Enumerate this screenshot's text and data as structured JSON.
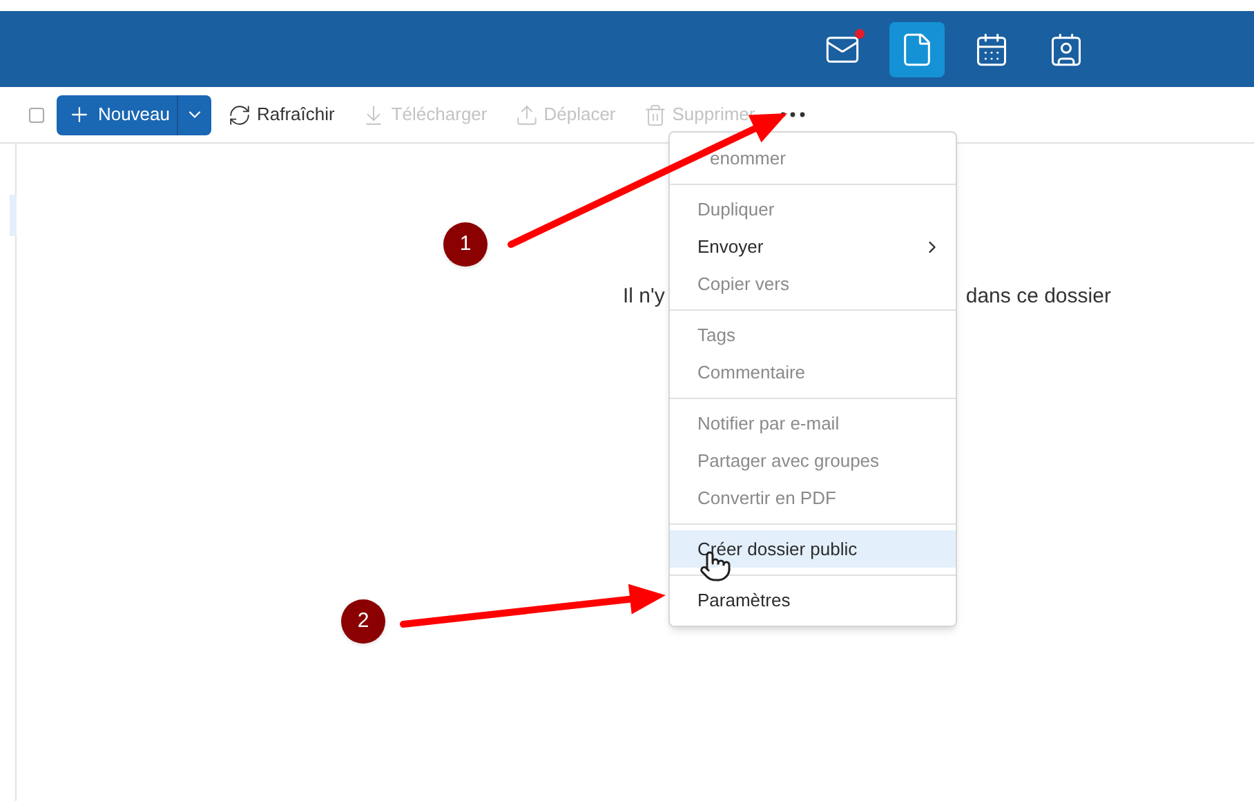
{
  "header": {
    "nav": [
      {
        "kind": "mail",
        "selected": false,
        "unread": true
      },
      {
        "kind": "files",
        "selected": true,
        "unread": false
      },
      {
        "kind": "calendar",
        "selected": false,
        "unread": false
      },
      {
        "kind": "contacts",
        "selected": false,
        "unread": false
      }
    ]
  },
  "toolbar": {
    "select_all": {
      "checked": false
    },
    "new_button": {
      "label": "Nouveau"
    },
    "actions": [
      {
        "kind": "refresh",
        "label": "Rafraîchir",
        "disabled": false
      },
      {
        "kind": "download",
        "label": "Télécharger",
        "disabled": true
      },
      {
        "kind": "move",
        "label": "Déplacer",
        "disabled": true
      },
      {
        "kind": "delete",
        "label": "Supprimer",
        "disabled": true
      }
    ]
  },
  "sidebar": {
    "items": [
      {
        "selected": true
      }
    ]
  },
  "empty_message": {
    "before": "Il n'y",
    "after": "dans ce dossier"
  },
  "context_menu": {
    "groups": [
      [
        {
          "label": "enommer",
          "disabled": true,
          "selected": false,
          "submenu": false
        }
      ],
      [
        {
          "label": "Dupliquer",
          "disabled": true,
          "selected": false,
          "submenu": false
        },
        {
          "label": "Envoyer",
          "disabled": false,
          "selected": false,
          "submenu": true
        },
        {
          "label": "Copier vers",
          "disabled": true,
          "selected": false,
          "submenu": false
        }
      ],
      [
        {
          "label": "Tags",
          "disabled": true,
          "selected": false,
          "submenu": false
        },
        {
          "label": "Commentaire",
          "disabled": true,
          "selected": false,
          "submenu": false
        }
      ],
      [
        {
          "label": "Notifier par e-mail",
          "disabled": true,
          "selected": false,
          "submenu": false
        },
        {
          "label": "Partager avec groupes",
          "disabled": true,
          "selected": false,
          "submenu": false
        },
        {
          "label": "Convertir en PDF",
          "disabled": true,
          "selected": false,
          "submenu": false
        }
      ],
      [
        {
          "label": "Créer dossier public",
          "disabled": false,
          "selected": true,
          "submenu": false
        }
      ],
      [
        {
          "label": "Paramètres",
          "disabled": false,
          "selected": false,
          "submenu": false
        }
      ]
    ]
  },
  "annotations": [
    {
      "number": "1"
    },
    {
      "number": "2"
    }
  ]
}
